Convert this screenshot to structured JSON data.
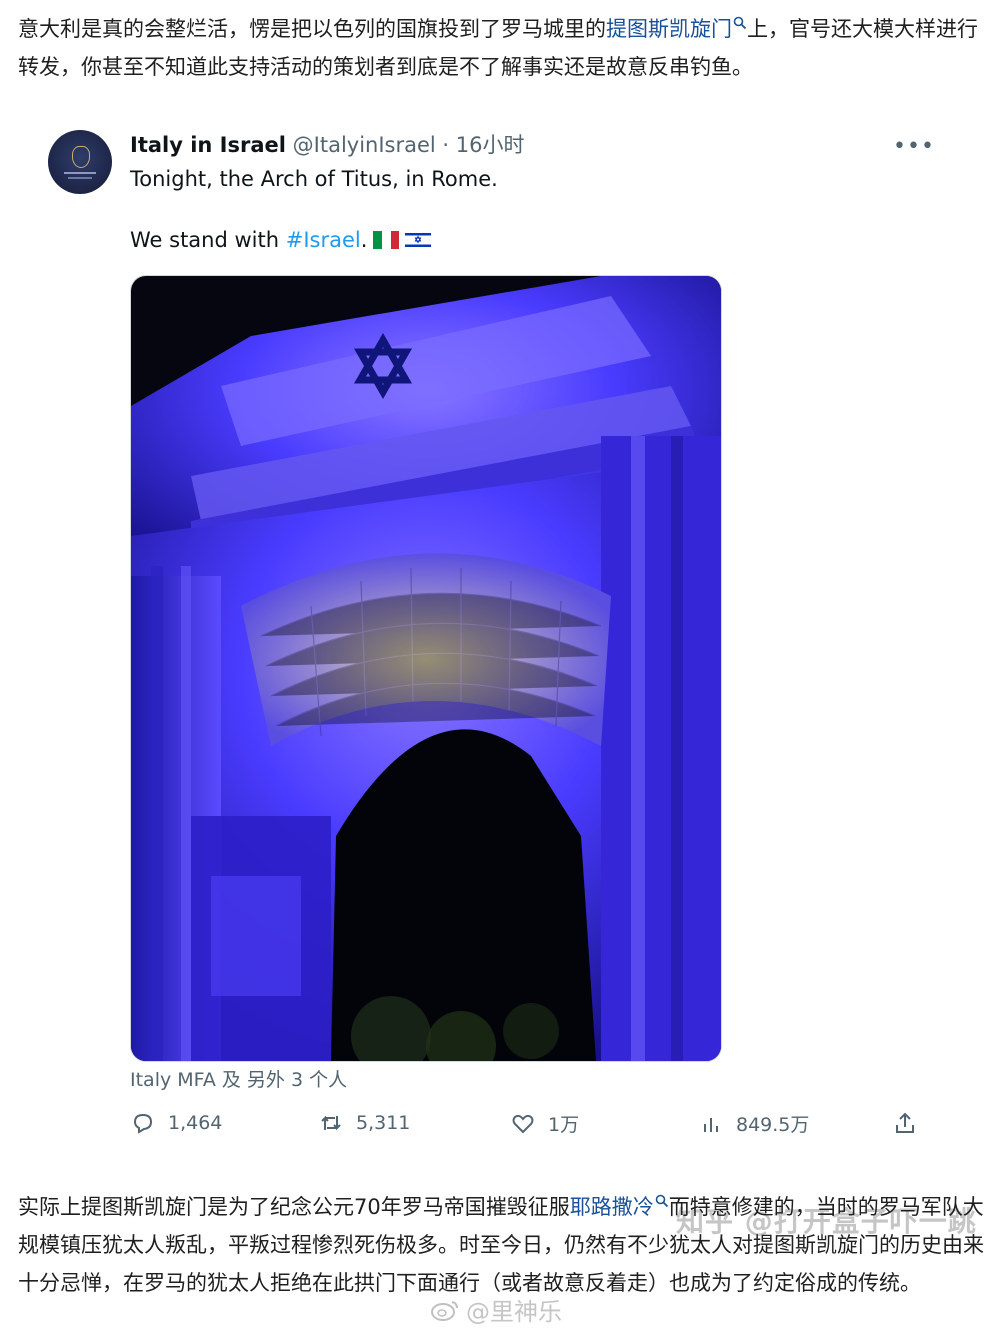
{
  "article": {
    "para_top": {
      "text_before": "意大利是真的会整烂活，愣是把以色列的国旗投到了罗马城里的",
      "link": "提图斯凯旋门",
      "text_after": "上，官号还大模大样进行转发，你甚至不知道此支持活动的策划者到底是不了解事实还是故意反串钓鱼。"
    },
    "para_bottom": {
      "text_before": "实际上提图斯凯旋门是为了纪念公元70年罗马帝国摧毁征服",
      "link": "耶路撒冷",
      "text_after": "而特意修建的，当时的罗马军队大规模镇压犹太人叛乱，平叛过程惨烈死伤极多。时至今日，仍然有不少犹太人对提图斯凯旋门的历史由来十分忌惮，在罗马的犹太人拒绝在此拱门下面通行（或者故意反着走）也成为了约定俗成的传统。"
    }
  },
  "tweet": {
    "author_name": "Italy in Israel",
    "author_meta": "@ItalyinIsrael · 16小时",
    "more": "•••",
    "line1": "Tonight, the Arch of Titus, in Rome.",
    "line2_before": "We stand with ",
    "hashtag": "#Israel",
    "line2_after": ".",
    "media_caption": "Italy MFA 及 另外 3 个人",
    "stats": {
      "replies": "1,464",
      "retweets": "5,311",
      "likes": "1万",
      "views": "849.5万"
    }
  },
  "watermarks": {
    "zhihu": "知乎 @打开盒子吓一跳",
    "weibo": "@里神乐"
  },
  "colors": {
    "link": "#175199",
    "hashtag": "#1d9bf0",
    "muted": "#536471",
    "arch_light": "#4a3cff"
  },
  "icons": [
    "search-icon",
    "reply-icon",
    "retweet-icon",
    "like-icon",
    "views-icon",
    "share-icon",
    "italy-flag-icon",
    "israel-flag-icon",
    "weibo-logo-icon"
  ]
}
